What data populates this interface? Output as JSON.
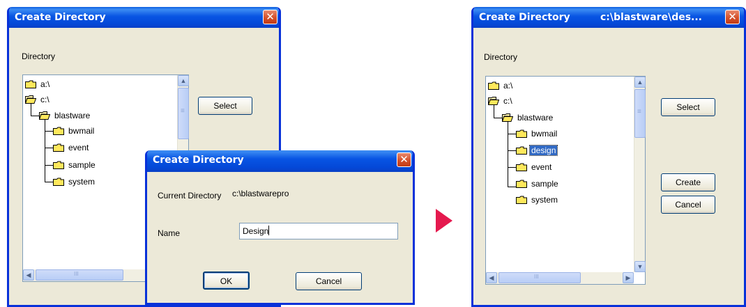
{
  "left_dialog": {
    "title": "Create Directory",
    "close_glyph": "✕",
    "directory_label": "Directory",
    "select_label": "Select",
    "tree": [
      "a:\\",
      "c:\\",
      "blastware",
      "bwmail",
      "event",
      "sample",
      "system"
    ],
    "scroll_grip": "≡",
    "hscroll_grip": "III"
  },
  "create_popup": {
    "title": "Create Directory",
    "close_glyph": "✕",
    "current_directory_label": "Current Directory",
    "current_directory_value": "c:\\blastwarepro",
    "name_label": "Name",
    "name_value": "Design",
    "ok_label": "OK",
    "cancel_label": "Cancel"
  },
  "right_dialog": {
    "title": "Create Directory",
    "title_path": "c:\\blastware\\des...",
    "close_glyph": "✕",
    "directory_label": "Directory",
    "select_label": "Select",
    "create_label": "Create",
    "cancel_label": "Cancel",
    "tree": [
      "a:\\",
      "c:\\",
      "blastware",
      "bwmail",
      "design",
      "event",
      "sample",
      "system"
    ],
    "selected_item": "design",
    "scroll_grip": "≡",
    "hscroll_grip": "III"
  },
  "scroll_arrows": {
    "up": "▲",
    "down": "▼",
    "left": "◀",
    "right": "▶"
  },
  "colors": {
    "titlebar": "#0854e3",
    "selection": "#316ac5",
    "arrow": "#e5194e",
    "folder": "#ffe85c"
  }
}
